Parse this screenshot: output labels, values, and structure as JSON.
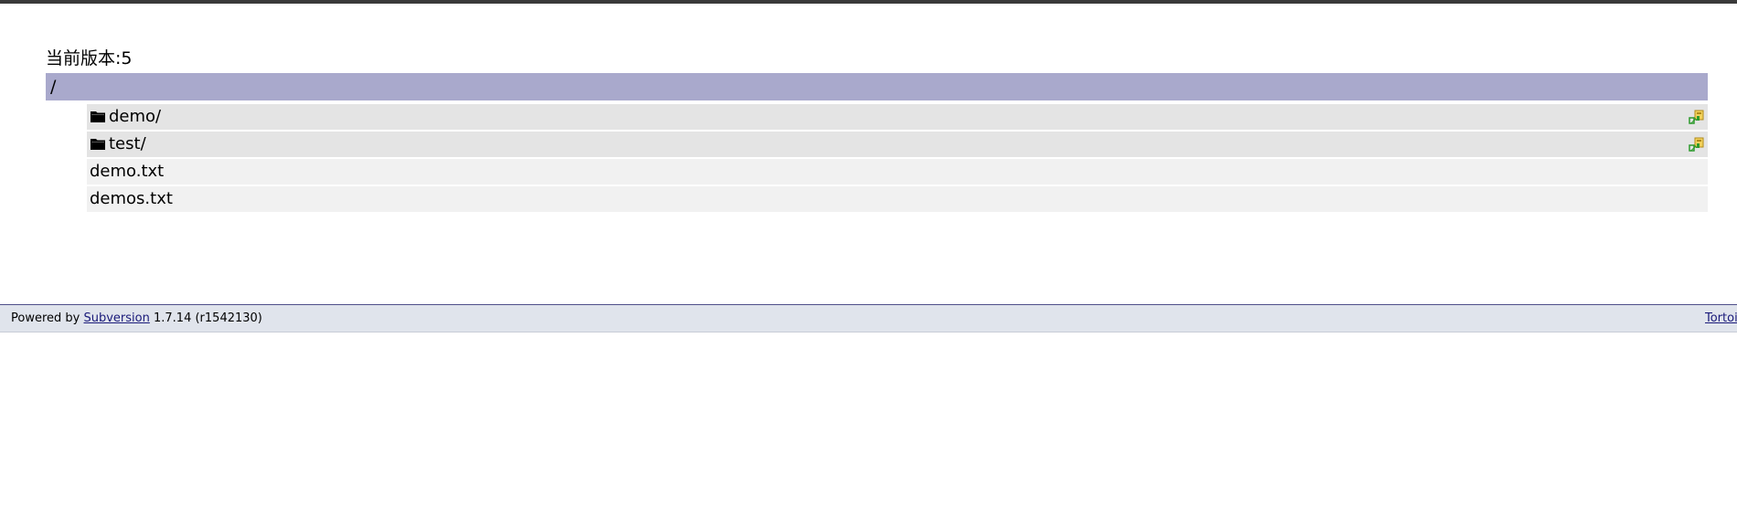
{
  "header": {
    "revision_text": "当前版本:5"
  },
  "path": {
    "current": "/"
  },
  "entries": [
    {
      "name": "demo/",
      "type": "dir",
      "icon": "folder-icon",
      "action_icon": "checkout-icon"
    },
    {
      "name": "test/",
      "type": "dir",
      "icon": "folder-icon",
      "action_icon": "checkout-icon"
    },
    {
      "name": "demo.txt",
      "type": "file"
    },
    {
      "name": "demos.txt",
      "type": "file"
    }
  ],
  "footer": {
    "powered_prefix": "Powered by",
    "subversion_link": "Subversion",
    "version": "1.7.14 (r1542130)",
    "right_link": "TortoiseSVN"
  },
  "colors": {
    "top_bar": "#3a3a3a",
    "path_bar": "#a9a9cc",
    "dir_row": "#e4e4e4",
    "file_row": "#f1f1f1",
    "footer_bg": "#e0e4ec",
    "link": "#1a1a7a"
  }
}
